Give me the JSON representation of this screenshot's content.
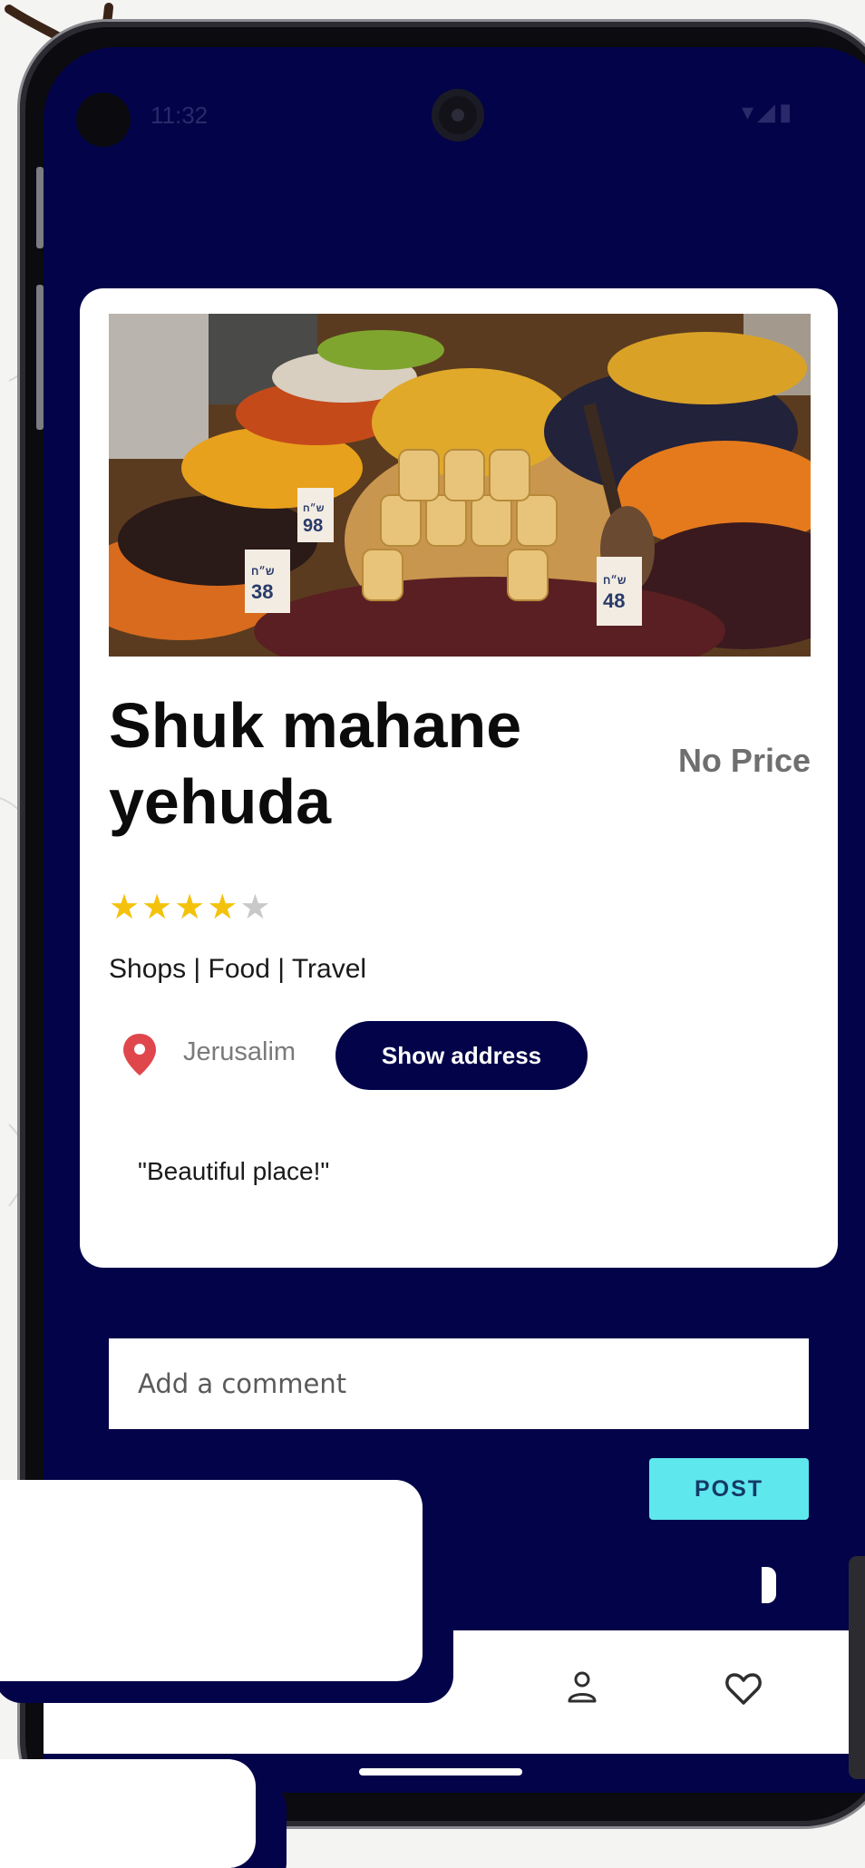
{
  "status_bar": {
    "time": "11:32",
    "icons": "▾◢▮"
  },
  "place": {
    "title": "Shuk mahane yehuda",
    "price": "No Price",
    "rating": 4,
    "rating_max": 5,
    "categories": "Shops | Food | Travel",
    "city": "Jerusalim",
    "show_address_label": "Show address",
    "review": "\"Beautiful place!\"",
    "photo_price_tags": [
      "98",
      "38",
      "48"
    ],
    "photo_tag_heading": "ש״ח"
  },
  "comment": {
    "placeholder": "Add a comment",
    "post_label": "POST"
  },
  "nav": {
    "icons": [
      "add-location-icon",
      "profile-icon",
      "heart-icon"
    ]
  },
  "colors": {
    "screen_bg": "#03034a",
    "card_bg": "#ffffff",
    "star": "#f4c20d",
    "post_button": "#5fe7ee",
    "pin": "#e0474c"
  }
}
